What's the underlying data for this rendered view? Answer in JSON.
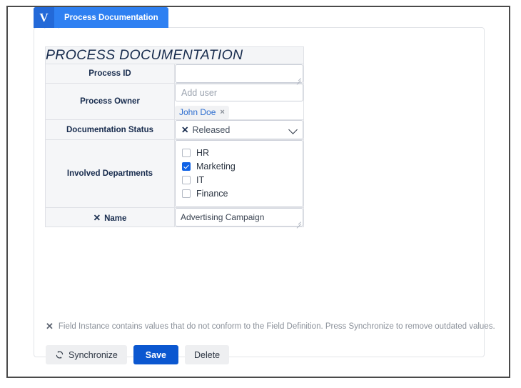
{
  "tab": {
    "logo_letter": "V",
    "logo_icon": "app-logo-icon",
    "label": "Process Documentation"
  },
  "form": {
    "title": "PROCESS DOCUMENTATION",
    "rows": [
      {
        "label": "Process ID",
        "type": "textarea",
        "value": "",
        "placeholder": ""
      },
      {
        "label": "Process Owner",
        "type": "user-picker",
        "placeholder": "Add user",
        "chips": [
          {
            "label": "John Doe",
            "remove_icon": "×"
          }
        ]
      },
      {
        "label": "Documentation Status",
        "type": "select",
        "x_prefix": "✕",
        "value": "Released",
        "chevron_icon": "chevron-down-icon"
      },
      {
        "label": "Involved Departments",
        "type": "checkbox-group",
        "options": [
          {
            "label": "HR",
            "checked": false
          },
          {
            "label": "Marketing",
            "checked": true
          },
          {
            "label": "IT",
            "checked": false
          },
          {
            "label": "Finance",
            "checked": false
          }
        ]
      },
      {
        "label": "Name",
        "x_prefix": "✕",
        "type": "textarea",
        "value": "Advertising Campaign"
      }
    ]
  },
  "warning": {
    "icon": "✕",
    "text": "Field Instance contains values that do not conform to the Field Definition. Press Synchronize to remove outdated values."
  },
  "buttons": {
    "synchronize": {
      "label": "Synchronize",
      "icon": "sync-icon"
    },
    "save": {
      "label": "Save"
    },
    "delete": {
      "label": "Delete"
    }
  },
  "colors": {
    "tab_blue": "#2e80f2",
    "logo_blue": "#2369d8",
    "primary_button_blue": "#0b57d0",
    "checkbox_blue": "#0f62e6",
    "chip_text_blue": "#2f6fd0",
    "header_gray": "#f4f5f7",
    "label_gray": "#f5f6f8",
    "border_gray": "#dfe1e6",
    "muted_text": "#8a9099"
  }
}
